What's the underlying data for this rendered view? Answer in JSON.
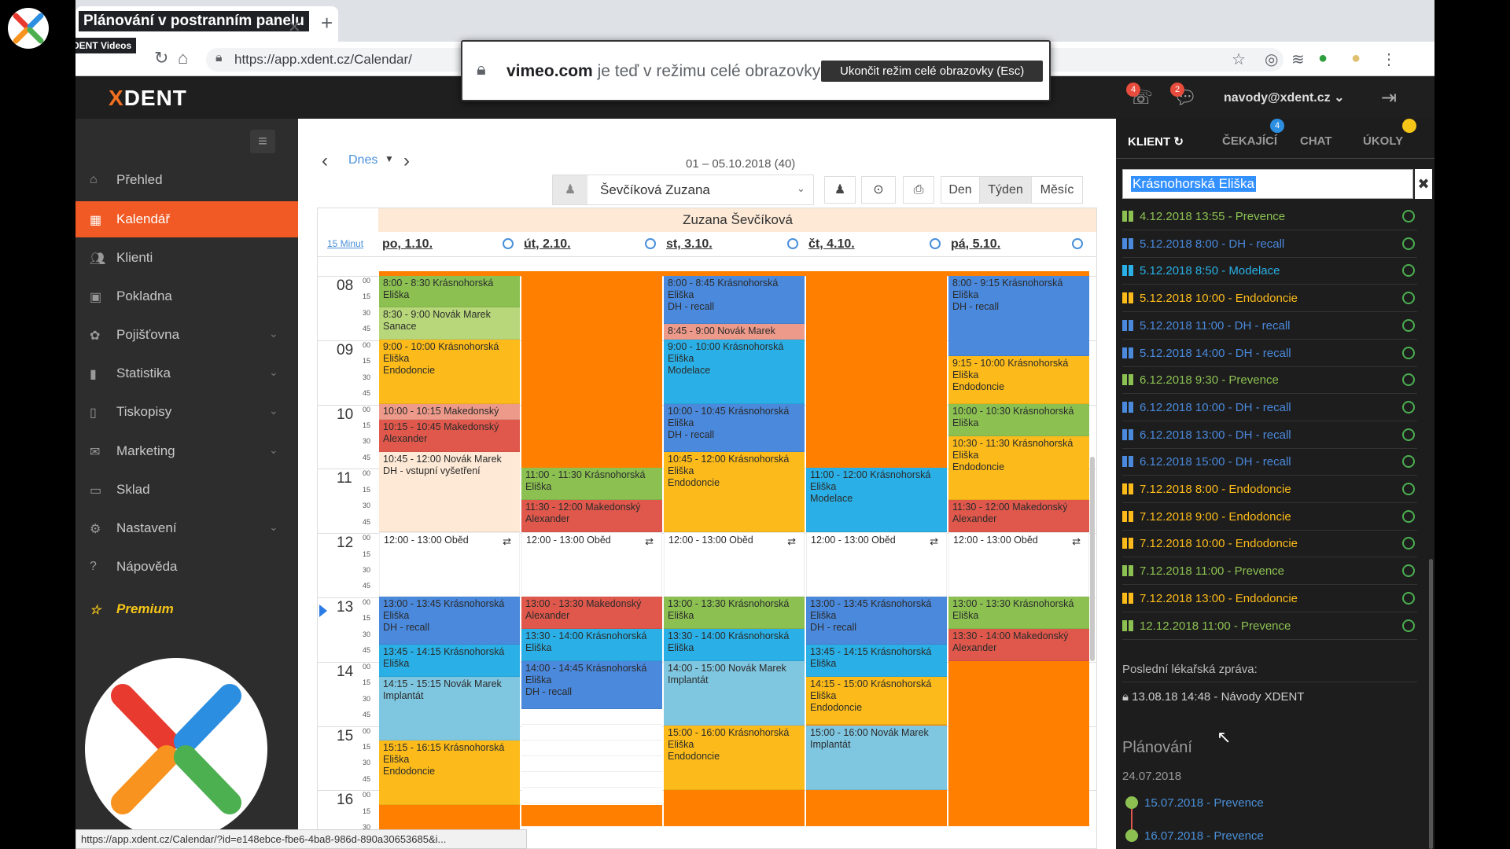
{
  "video_overlay": {
    "title": "Plánování v postranním panelu",
    "channel": "XDENT Videos"
  },
  "browser": {
    "tab_title": "Plánování v postranním panelu",
    "url": "https://app.xdent.cz/Calendar/",
    "status_url": "https://app.xdent.cz/Calendar/?id=e148ebce-fbe6-4ba8-986d-890a30653685&i..."
  },
  "fullscreen_notice": {
    "site": "vimeo.com",
    "message": "je teď v režimu celé obrazovky",
    "exit_button": "Ukončit režim celé obrazovky (Esc)"
  },
  "header": {
    "logo_x": "X",
    "logo_rest": "DENT",
    "notif1_count": "4",
    "notif2_count": "2",
    "user": "navody@xdent.cz"
  },
  "sidebar": {
    "items": [
      {
        "label": "Přehled",
        "icon": "home-icon"
      },
      {
        "label": "Kalendář",
        "icon": "calendar-icon"
      },
      {
        "label": "Klienti",
        "icon": "users-icon"
      },
      {
        "label": "Pokladna",
        "icon": "money-icon"
      },
      {
        "label": "Pojišťovna",
        "icon": "insurance-icon"
      },
      {
        "label": "Statistika",
        "icon": "bar-chart-icon"
      },
      {
        "label": "Tiskopisy",
        "icon": "document-icon"
      },
      {
        "label": "Marketing",
        "icon": "envelope-icon"
      },
      {
        "label": "Sklad",
        "icon": "warehouse-icon"
      },
      {
        "label": "Nastavení",
        "icon": "gears-icon"
      },
      {
        "label": "Nápověda",
        "icon": "help-icon"
      },
      {
        "label": "Premium",
        "icon": "star-icon"
      }
    ]
  },
  "calendar": {
    "today_label": "Dnes",
    "range": "01 – 05.10.2018 (40)",
    "dentist": "Ševčíková Zuzana",
    "views": [
      "Den",
      "Týden",
      "Měsíc"
    ],
    "active_view": "Týden",
    "grid_title": "Zuzana Ševčíková",
    "interval_label": "15 Minut",
    "days": [
      "po, 1.10.",
      "út, 2.10.",
      "st, 3.10.",
      "čt, 4.10.",
      "pá, 5.10."
    ],
    "hours": [
      "08",
      "09",
      "10",
      "11",
      "12",
      "13",
      "14",
      "15",
      "16"
    ],
    "quarters": [
      "00",
      "15",
      "30",
      "45"
    ],
    "colors": {
      "green": "#8cc152",
      "lightgreen": "#b7d77a",
      "yellow": "#fcbb1a",
      "red": "#e0584c",
      "salmon": "#ee9a8a",
      "blue": "#4a89dc",
      "cyan": "#2ab0e6",
      "lightblue": "#7fc6e0",
      "white": "#ffffff",
      "peach": "#fde9d5",
      "orange": "#ff7f00"
    }
  },
  "client_panel": {
    "tabs": [
      "KLIENT",
      "ČEKAJÍCÍ",
      "CHAT",
      "ÚKOLY"
    ],
    "waiting_badge": "4",
    "search_value": "Krásnohorská Eliška",
    "appointments": [
      {
        "text": "4.12.2018 13:55 - Prevence",
        "color": "#8cc152"
      },
      {
        "text": "5.12.2018 8:00 - DH - recall",
        "color": "#4a89dc"
      },
      {
        "text": "5.12.2018 8:50 - Modelace",
        "color": "#2ab0e6"
      },
      {
        "text": "5.12.2018 10:00 - Endodoncie",
        "color": "#fcbb1a"
      },
      {
        "text": "5.12.2018 11:00 - DH - recall",
        "color": "#4a89dc"
      },
      {
        "text": "5.12.2018 14:00 - DH - recall",
        "color": "#4a89dc"
      },
      {
        "text": "6.12.2018 9:30 - Prevence",
        "color": "#8cc152"
      },
      {
        "text": "6.12.2018 10:00 - DH - recall",
        "color": "#4a89dc"
      },
      {
        "text": "6.12.2018 13:00 - DH - recall",
        "color": "#4a89dc"
      },
      {
        "text": "6.12.2018 15:00 - DH - recall",
        "color": "#4a89dc"
      },
      {
        "text": "7.12.2018 8:00 - Endodoncie",
        "color": "#fcbb1a"
      },
      {
        "text": "7.12.2018 9:00 - Endodoncie",
        "color": "#fcbb1a"
      },
      {
        "text": "7.12.2018 10:00 - Endodoncie",
        "color": "#fcbb1a"
      },
      {
        "text": "7.12.2018 11:00 - Prevence",
        "color": "#8cc152"
      },
      {
        "text": "7.12.2018 13:00 - Endodoncie",
        "color": "#fcbb1a"
      },
      {
        "text": "12.12.2018 11:00 - Prevence",
        "color": "#8cc152"
      }
    ],
    "last_report_label": "Poslední lékařská zpráva:",
    "last_report": "13.08.18 14:48 - Návody XDENT",
    "planning_label": "Plánování",
    "planning_date": "24.07.2018",
    "planning_items": [
      "15.07.2018 - Prevence",
      "16.07.2018 - Prevence"
    ]
  }
}
